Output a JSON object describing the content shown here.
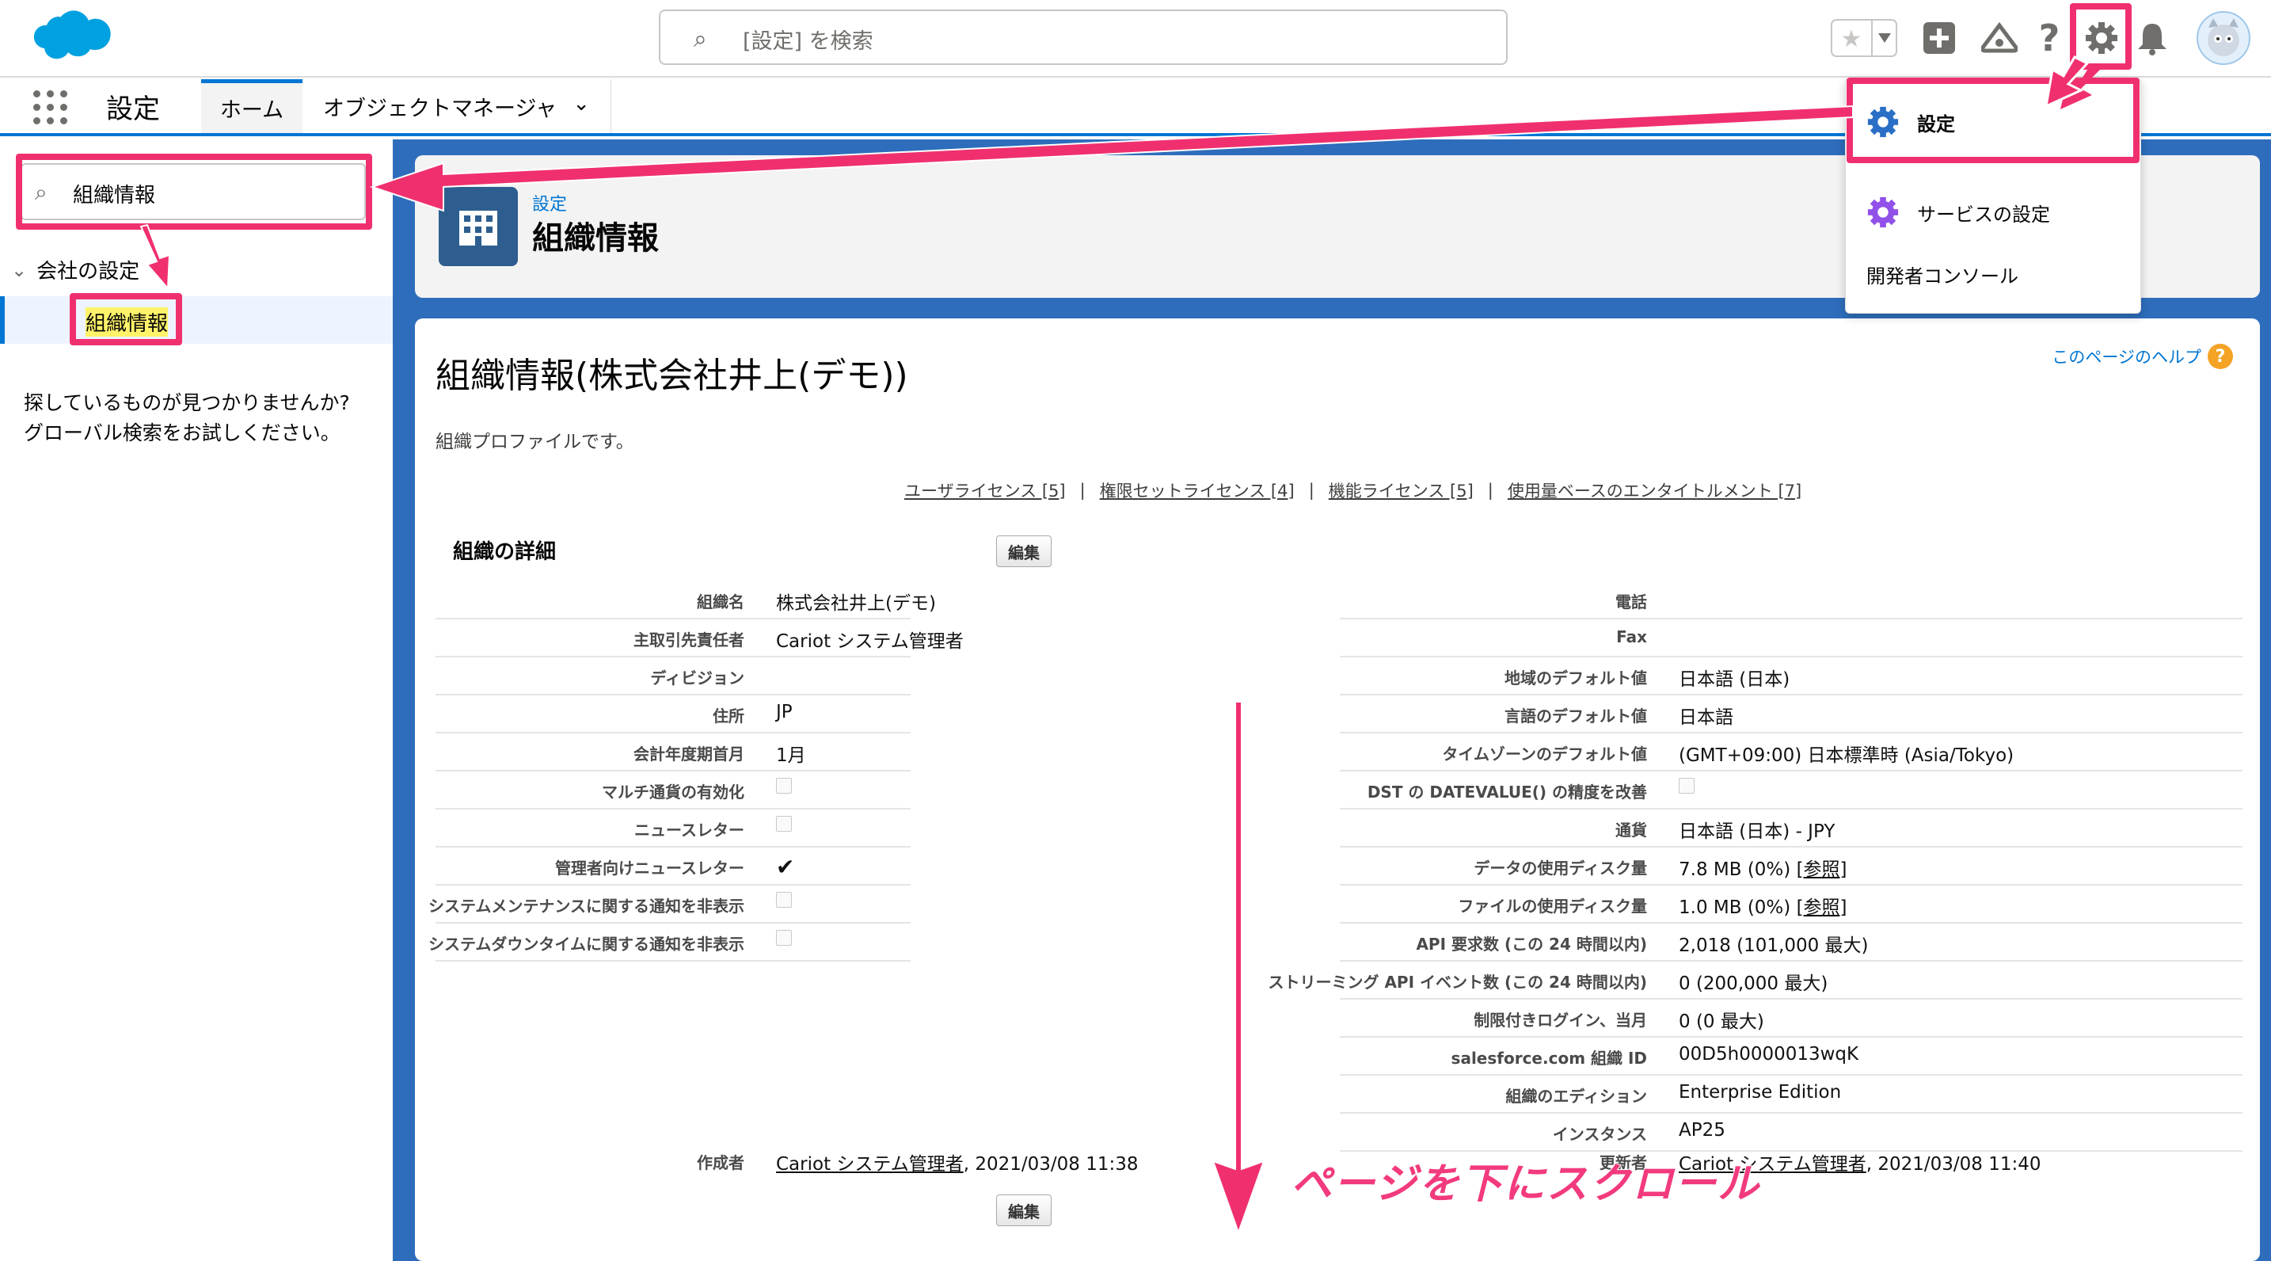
{
  "header": {
    "search_placeholder": "[設定] を検索",
    "icons": [
      "favorites-star-icon",
      "add-icon",
      "trailhead-icon",
      "help-icon",
      "setup-gear-icon",
      "notification-bell-icon",
      "user-avatar"
    ]
  },
  "nav": {
    "app_title": "設定",
    "tabs": [
      {
        "label": "ホーム"
      },
      {
        "label": "オブジェクトマネージャ"
      }
    ]
  },
  "sidebar": {
    "quick_find_value": "組織情報",
    "tree_parent": "会社の設定",
    "tree_child": "組織情報",
    "not_found_line1": "探しているものが見つかりませんか?",
    "not_found_line2": "グローバル検索をお試しください。"
  },
  "page_header": {
    "subtitle": "設定",
    "title": "組織情報"
  },
  "content": {
    "help_link": "このページのヘルプ",
    "title": "組織情報(株式会社井上(デモ))",
    "description": "組織プロファイルです。",
    "links": [
      {
        "label": "ユーザライセンス [5]"
      },
      {
        "label": "権限セットライセンス [4]"
      },
      {
        "label": "機能ライセンス [5]"
      },
      {
        "label": "使用量ベースのエンタイトルメント [7]"
      }
    ],
    "section_title": "組織の詳細",
    "edit_button": "編集",
    "left_fields": [
      {
        "label": "組織名",
        "value": "株式会社井上(デモ)"
      },
      {
        "label": "主取引先責任者",
        "value": "Cariot システム管理者"
      },
      {
        "label": "ディビジョン",
        "value": ""
      },
      {
        "label": "住所",
        "value": "JP"
      },
      {
        "label": "会計年度期首月",
        "value": "1月"
      },
      {
        "label": "マルチ通貨の有効化",
        "value": "checkbox-off"
      },
      {
        "label": "ニュースレター",
        "value": "checkbox-off"
      },
      {
        "label": "管理者向けニュースレター",
        "value": "✔"
      },
      {
        "label": "システムメンテナンスに関する通知を非表示",
        "value": "checkbox-off"
      },
      {
        "label": "システムダウンタイムに関する通知を非表示",
        "value": "checkbox-off"
      }
    ],
    "right_fields": [
      {
        "label": "電話",
        "value": ""
      },
      {
        "label": "Fax",
        "value": ""
      },
      {
        "label": "地域のデフォルト値",
        "value": "日本語 (日本)"
      },
      {
        "label": "言語のデフォルト値",
        "value": "日本語"
      },
      {
        "label": "タイムゾーンのデフォルト値",
        "value": "(GMT+09:00) 日本標準時 (Asia/Tokyo)"
      },
      {
        "label": "DST の DATEVALUE() の精度を改善",
        "value": "checkbox-off"
      },
      {
        "label": "通貨",
        "value": "日本語 (日本) - JPY"
      },
      {
        "label": "データの使用ディスク量",
        "value": "7.8 MB (0%) ",
        "link": "[参照]"
      },
      {
        "label": "ファイルの使用ディスク量",
        "value": "1.0 MB (0%) ",
        "link": "[参照]"
      },
      {
        "label": "API 要求数 (この 24 時間以内)",
        "value": "2,018 (101,000 最大)"
      },
      {
        "label": "ストリーミング API イベント数 (この 24 時間以内)",
        "value": "0 (200,000 最大)"
      },
      {
        "label": "制限付きログイン、当月",
        "value": "0 (0 最大)"
      },
      {
        "label": "salesforce.com 組織 ID",
        "value": "00D5h0000013wqK"
      },
      {
        "label": "組織のエディション",
        "value": "Enterprise Edition"
      },
      {
        "label": "インスタンス",
        "value": "AP25"
      }
    ],
    "created_by_label": "作成者",
    "created_by_link": "Cariot システム管理者",
    "created_by_date": ", 2021/03/08 11:38",
    "modified_by_label": "更新者",
    "modified_by_link": "Cariot システム管理者",
    "modified_by_date": ", 2021/03/08 11:40"
  },
  "gear_menu": {
    "items": [
      {
        "label": "設定"
      },
      {
        "label": "サービスの設定"
      },
      {
        "label": "開発者コンソール"
      }
    ]
  },
  "annotation": {
    "scroll_text": "ページを下にスクロール",
    "highlight_color": "#f0306e"
  },
  "colors": {
    "brand": "#0176d3",
    "nav_bg": "#2e6dbb",
    "accent_pink": "#f0306e"
  }
}
